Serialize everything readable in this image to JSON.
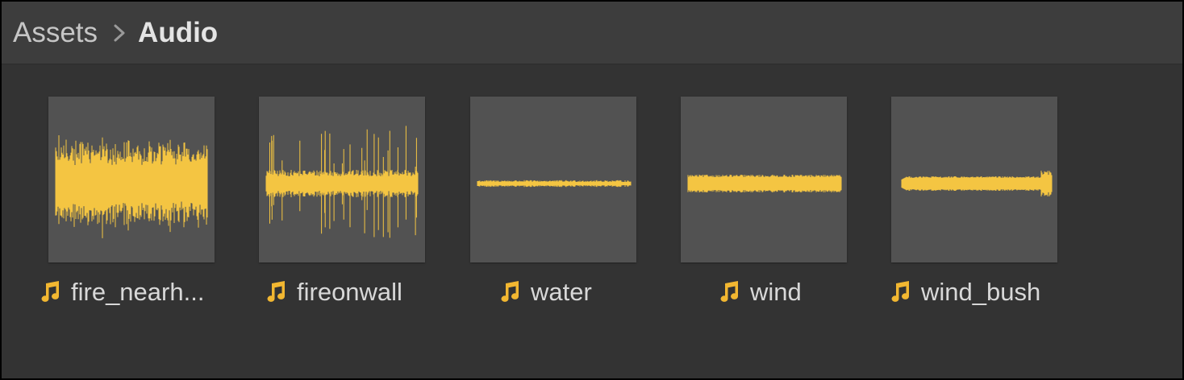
{
  "breadcrumb": {
    "items": [
      {
        "label": "Assets"
      },
      {
        "label": "Audio"
      }
    ]
  },
  "assets": [
    {
      "label": "fire_nearh...",
      "icon": "audio-clip-icon",
      "waveform": "dense"
    },
    {
      "label": "fireonwall",
      "icon": "audio-clip-icon",
      "waveform": "spiky"
    },
    {
      "label": "water",
      "icon": "audio-clip-icon",
      "waveform": "thin"
    },
    {
      "label": "wind",
      "icon": "audio-clip-icon",
      "waveform": "band"
    },
    {
      "label": "wind_bush",
      "icon": "audio-clip-icon",
      "waveform": "tapered"
    }
  ],
  "colors": {
    "waveform": "#f4c542",
    "icon": "#f2b731",
    "thumb_bg": "#525252",
    "panel_bg": "#333333",
    "header_bg": "#3d3d3d"
  }
}
